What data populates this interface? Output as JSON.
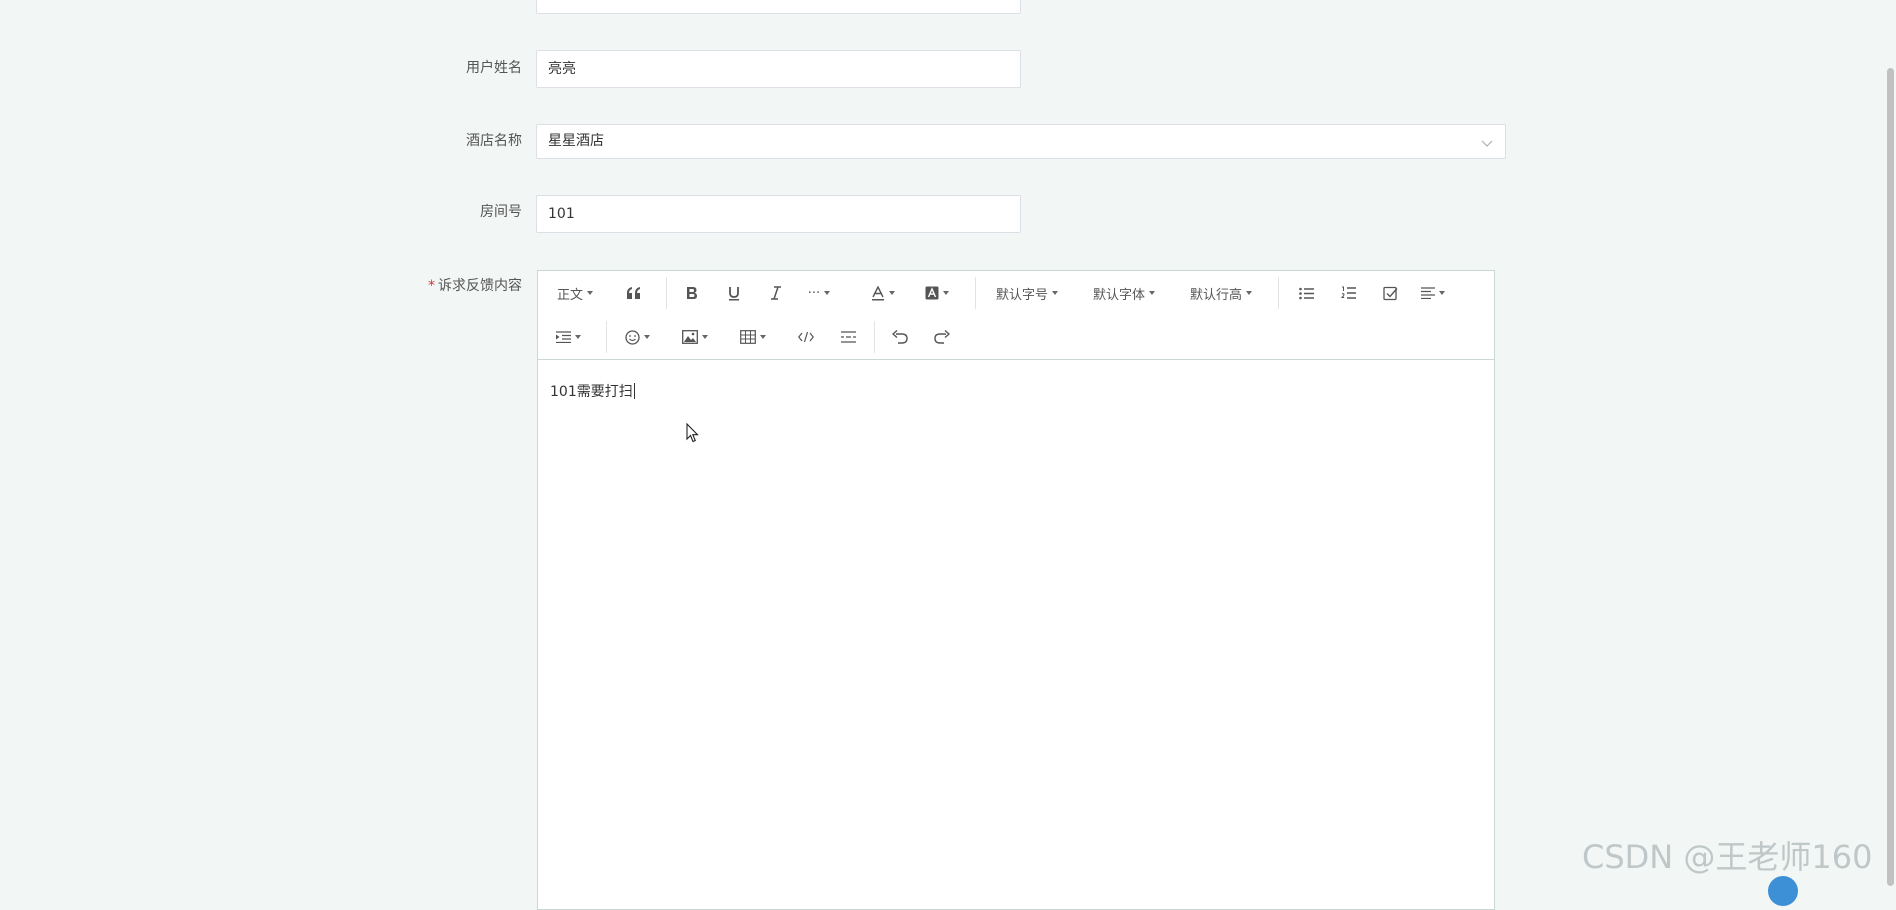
{
  "form": {
    "user_name": {
      "label": "用户姓名",
      "value": "亮亮"
    },
    "hotel_name": {
      "label": "酒店名称",
      "value": "星星酒店"
    },
    "room_number": {
      "label": "房间号",
      "value": "101"
    },
    "feedback": {
      "label": "诉求反馈内容",
      "required_mark": "*"
    }
  },
  "editor": {
    "toolbar": {
      "paragraph": "正文",
      "font_size": "默认字号",
      "font_family": "默认字体",
      "line_height": "默认行高",
      "more": "···"
    },
    "content": "101需要打扫"
  },
  "watermark": "CSDN @王老师160",
  "colors": {
    "page_bg": "#f2f6f4",
    "required": "#e0303a",
    "border": "#dcdfe6"
  },
  "icons": [
    "quote-icon",
    "bold-icon",
    "underline-icon",
    "italic-icon",
    "font-color-icon",
    "background-color-icon",
    "bullet-list-icon",
    "numbered-list-icon",
    "todo-icon",
    "align-icon",
    "indent-icon",
    "emoji-icon",
    "image-icon",
    "table-icon",
    "code-icon",
    "divider-icon",
    "undo-icon",
    "redo-icon",
    "chevron-down-icon"
  ]
}
